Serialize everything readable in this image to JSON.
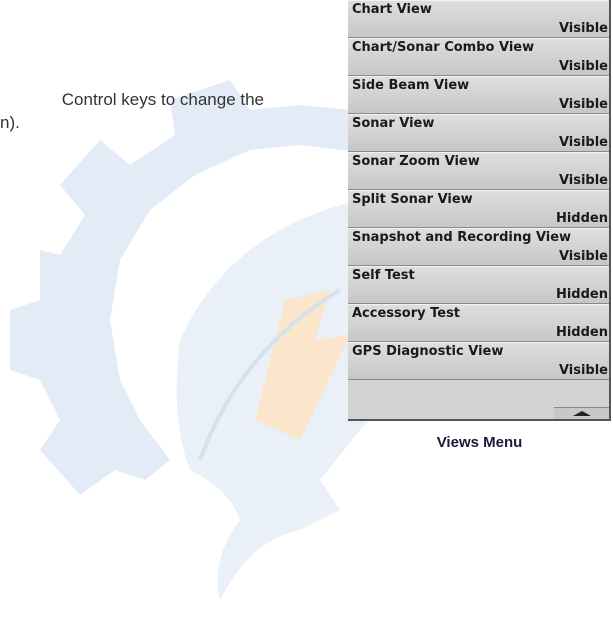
{
  "body_text": {
    "line1": "Control keys to change the",
    "line2": "n)."
  },
  "menu": {
    "items": [
      {
        "label": "Chart View",
        "state": "Visible"
      },
      {
        "label": "Chart/Sonar Combo View",
        "state": "Visible"
      },
      {
        "label": "Side Beam View",
        "state": "Visible"
      },
      {
        "label": "Sonar View",
        "state": "Visible"
      },
      {
        "label": "Sonar Zoom View",
        "state": "Visible"
      },
      {
        "label": "Split Sonar View",
        "state": "Hidden"
      },
      {
        "label": "Snapshot and Recording View",
        "state": "Visible"
      },
      {
        "label": "Self Test",
        "state": "Hidden"
      },
      {
        "label": "Accessory Test",
        "state": "Hidden"
      },
      {
        "label": "GPS Diagnostic View",
        "state": "Visible"
      }
    ],
    "scroll_icon": "scroll-up-arrow-icon"
  },
  "caption": "Views Menu",
  "watermark": {
    "icon": "gear-logo-watermark",
    "colors": {
      "blue": "#e3ecf6",
      "orange": "#fbe6cc"
    }
  }
}
